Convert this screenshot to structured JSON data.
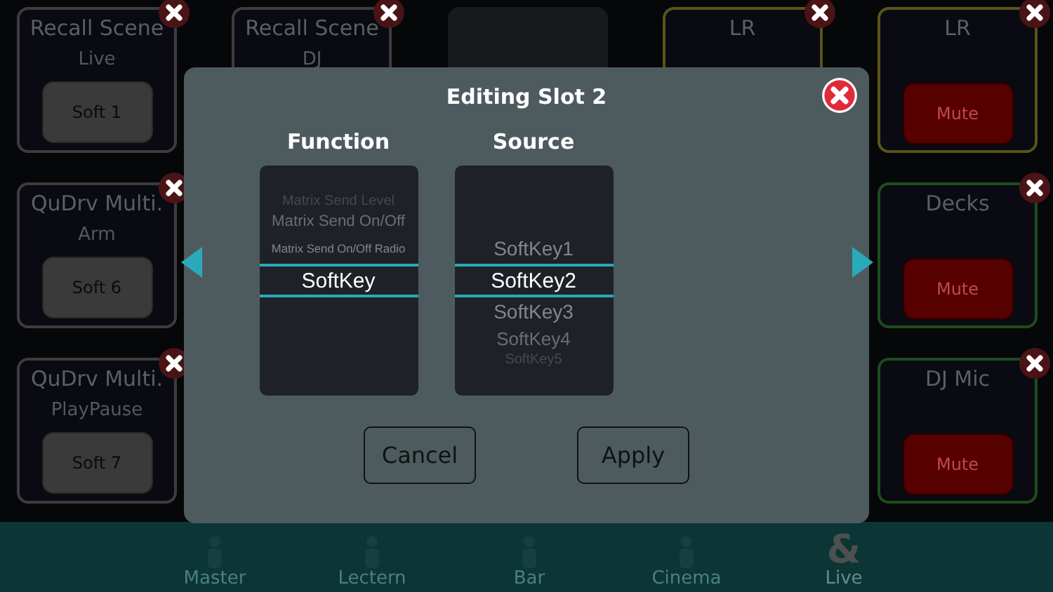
{
  "columns": [
    {
      "tiles": [
        {
          "title": "Recall Scene",
          "subtitle": "Live",
          "button": "Soft 1",
          "kind": "soft",
          "color": "#3d3d40"
        },
        {
          "title": "QuDrv Multi.",
          "subtitle": "Arm",
          "button": "Soft 6",
          "kind": "soft",
          "color": "#3d3d40"
        },
        {
          "title": "QuDrv Multi.",
          "subtitle": "PlayPause",
          "button": "Soft 7",
          "kind": "soft",
          "color": "#3d3d40"
        }
      ]
    },
    {
      "tiles": [
        {
          "title": "Recall Scene",
          "subtitle": "DJ",
          "kind": "soft",
          "color": "#3d3d40"
        }
      ]
    },
    {
      "tiles": [
        {
          "kind": "blank"
        }
      ]
    },
    {
      "tiles": [
        {
          "title": "LR",
          "kind": "mute",
          "color": "#5a5518"
        }
      ]
    },
    {
      "tiles": [
        {
          "title": "LR",
          "button": "Mute",
          "kind": "mute",
          "color": "#5a5518"
        },
        {
          "title": "Decks",
          "button": "Mute",
          "kind": "mute",
          "color": "#1d4d1d"
        },
        {
          "title": "DJ Mic",
          "button": "Mute",
          "kind": "mute",
          "color": "#1d4d1d"
        }
      ]
    }
  ],
  "tabs": [
    {
      "label": "Master",
      "selected": false
    },
    {
      "label": "Lectern",
      "selected": false
    },
    {
      "label": "Bar",
      "selected": false
    },
    {
      "label": "Cinema",
      "selected": false
    },
    {
      "label": "Live",
      "glyph": "&",
      "selected": true
    }
  ],
  "dialog": {
    "title": "Editing Slot 2",
    "pickers": [
      {
        "label": "Function",
        "items": [
          {
            "text": "Matrix Send Level",
            "selected": false
          },
          {
            "text": "Matrix Send On/Off",
            "selected": false
          },
          {
            "text": "Matrix Send On/Off Radio",
            "selected": false
          },
          {
            "text": "SoftKey",
            "selected": true
          }
        ]
      },
      {
        "label": "Source",
        "items": [
          {
            "text": "SoftKey1",
            "selected": false
          },
          {
            "text": "SoftKey2",
            "selected": true
          },
          {
            "text": "SoftKey3",
            "selected": false
          },
          {
            "text": "SoftKey4",
            "selected": false
          },
          {
            "text": "SoftKey5",
            "selected": false
          }
        ]
      }
    ],
    "buttons": [
      "Cancel",
      "Apply"
    ]
  }
}
